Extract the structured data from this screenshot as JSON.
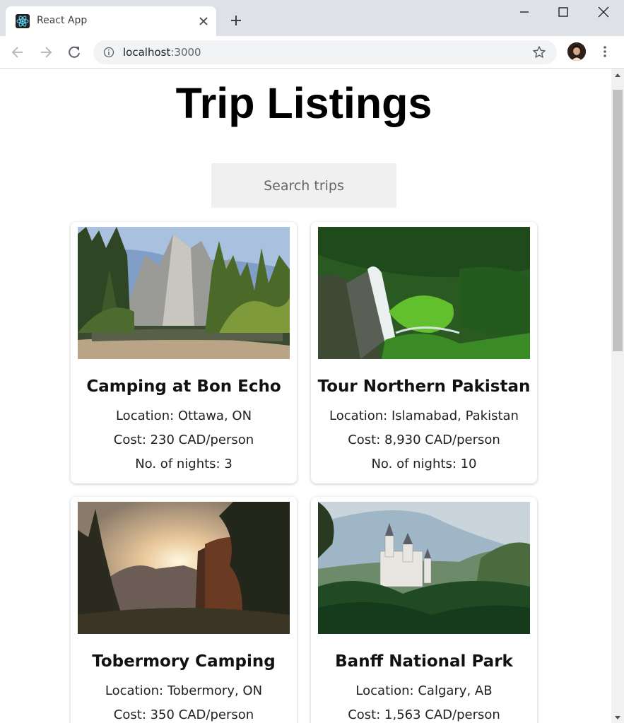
{
  "browser": {
    "tab_title": "React App",
    "url_host": "localhost",
    "url_port": ":3000"
  },
  "page": {
    "title": "Trip Listings",
    "search_placeholder": "Search trips"
  },
  "trips": [
    {
      "name": "Camping at Bon Echo",
      "location": "Location: Ottawa, ON",
      "cost": "Cost: 230 CAD/person",
      "nights": "No. of nights: 3",
      "image": "forest-mountain-lake"
    },
    {
      "name": "Tour Northern Pakistan",
      "location": "Location: Islamabad, Pakistan",
      "cost": "Cost: 8,930 CAD/person",
      "nights": "No. of nights: 10",
      "image": "waterfall-green-valley"
    },
    {
      "name": "Tobermory Camping",
      "location": "Location: Tobermory, ON",
      "cost": "Cost: 350 CAD/person",
      "image": "sunset-forest-cliff"
    },
    {
      "name": "Banff National Park",
      "location": "Location: Calgary, AB",
      "cost": "Cost: 1,563 CAD/person",
      "image": "castle-forest-valley"
    }
  ]
}
